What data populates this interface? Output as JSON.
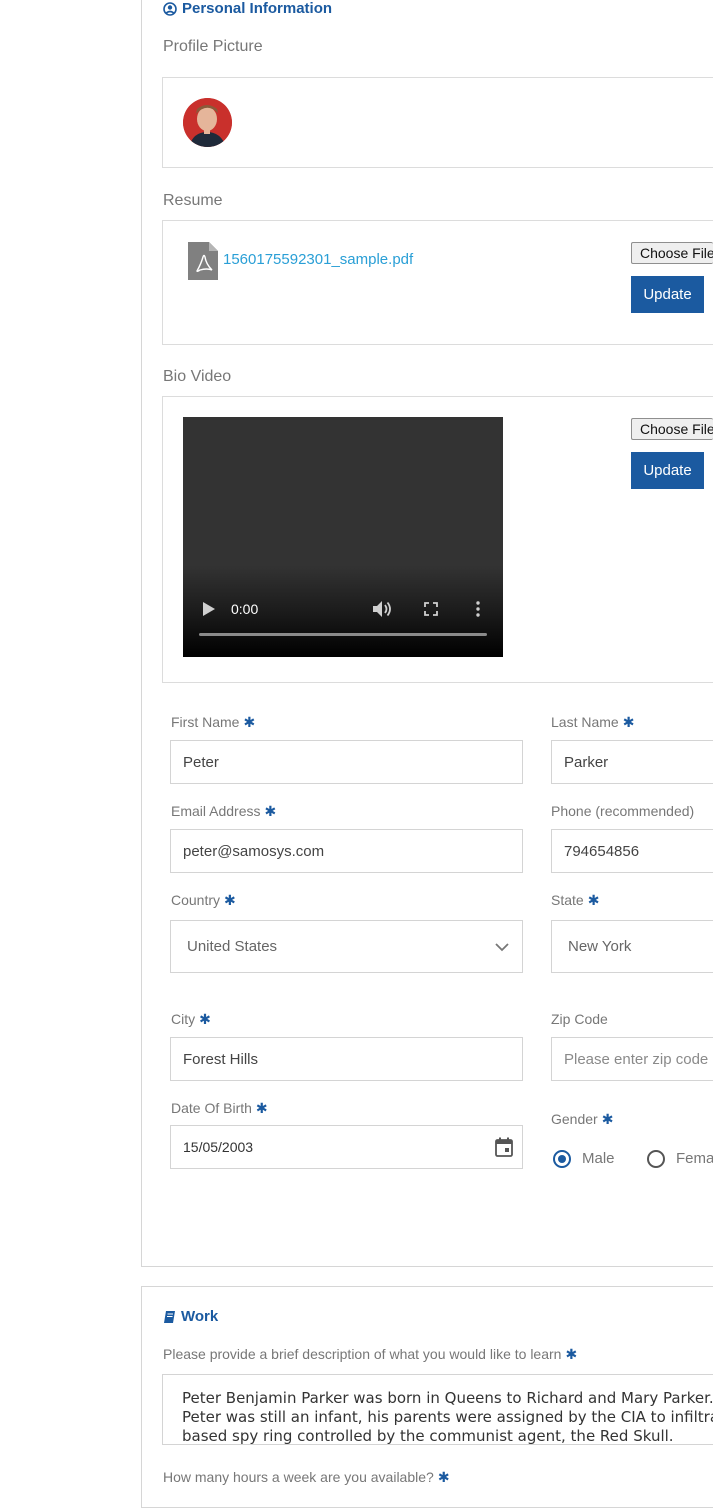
{
  "personal": {
    "title": "Personal Information",
    "profile_picture_label": "Profile Picture",
    "resume_label": "Resume",
    "resume_filename": "1560175592301_sample.pdf",
    "bio_video_label": "Bio Video",
    "choose_file_label": "Choose File",
    "update_label": "Update",
    "video_time": "0:00",
    "form": {
      "first_name_label": "First Name",
      "first_name_value": "Peter",
      "last_name_label": "Last Name",
      "last_name_value": "Parker",
      "email_label": "Email Address",
      "email_value": "peter@samosys.com",
      "phone_label": "Phone (recommended)",
      "phone_value": "794654856",
      "country_label": "Country",
      "country_value": "United States",
      "state_label": "State",
      "state_value": "New York",
      "city_label": "City",
      "city_value": "Forest Hills",
      "zip_label": "Zip Code",
      "zip_placeholder": "Please enter zip code",
      "dob_label": "Date Of Birth",
      "dob_value": "15/05/2003",
      "gender_label": "Gender",
      "gender_options": [
        "Male",
        "Female"
      ],
      "gender_selected": "Male",
      "required_mark": "✱"
    }
  },
  "work": {
    "title": "Work",
    "learn_label": "Please provide a brief description of what you would like to learn",
    "learn_text_lines": [
      "Peter Benjamin Parker was born in Queens to Richard and Mary Parker.",
      "Peter was still an infant, his parents were assigned by the CIA to infiltrate",
      "based spy ring controlled by the communist agent, the Red Skull."
    ],
    "hours_label": "How many hours a week are you available?"
  },
  "colors": {
    "accent": "#1b5aa0",
    "link": "#2a9fd6"
  }
}
